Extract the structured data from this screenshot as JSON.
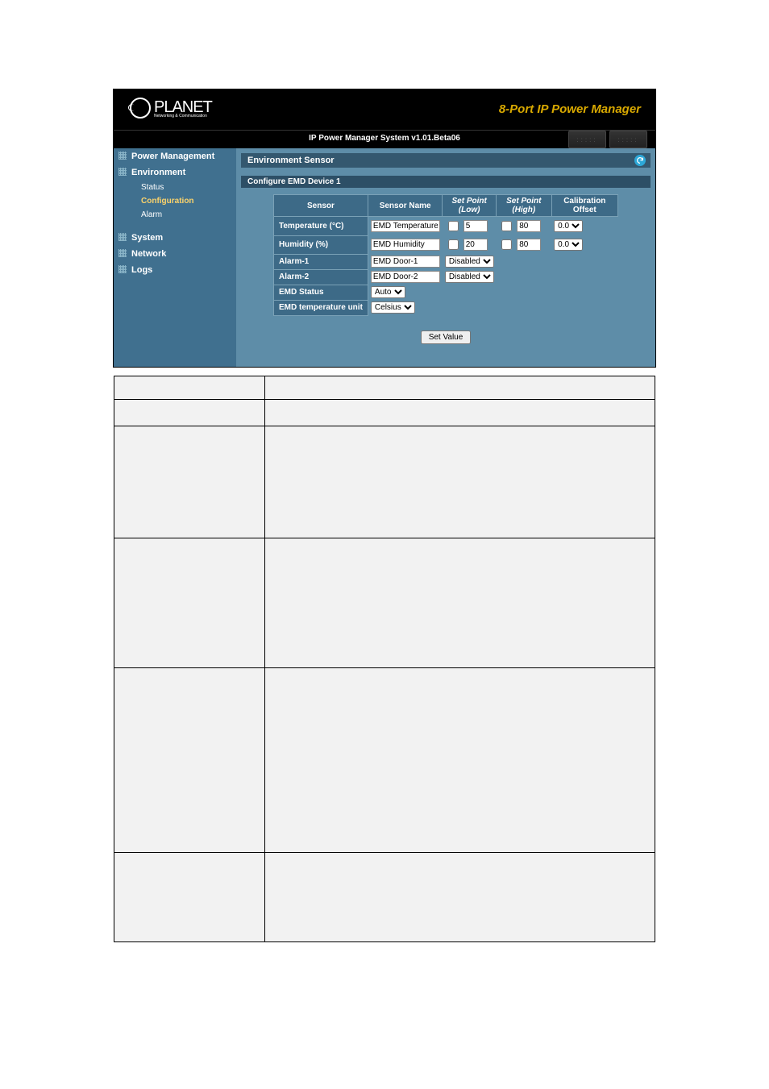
{
  "branding": {
    "logo_text": "PLANET",
    "logo_sub": "Networking & Communication"
  },
  "product_title": "8-Port IP Power Manager",
  "system_status": "IP Power Manager System v1.01.Beta06",
  "sidebar": {
    "items": [
      {
        "label": "Power Management",
        "type": "top",
        "active": false
      },
      {
        "label": "Environment",
        "type": "top",
        "active": false
      },
      {
        "label": "Status",
        "type": "sub",
        "active": false
      },
      {
        "label": "Configuration",
        "type": "sub",
        "active": true
      },
      {
        "label": "Alarm",
        "type": "sub",
        "active": false
      },
      {
        "label": "System",
        "type": "top",
        "active": false
      },
      {
        "label": "Network",
        "type": "top",
        "active": false
      },
      {
        "label": "Logs",
        "type": "top",
        "active": false
      }
    ]
  },
  "main": {
    "section_title": "Environment Sensor",
    "sub_title": "Configure EMD Device 1",
    "headers": {
      "sensor": "Sensor",
      "sensor_name": "Sensor Name",
      "sp_low": "Set Point (Low)",
      "sp_high": "Set Point (High)",
      "calib": "Calibration Offset"
    },
    "rows": {
      "temp": {
        "label": "Temperature (°C)",
        "name": "EMD Temperature",
        "low_chk": false,
        "low_val": "5",
        "high_chk": false,
        "high_val": "80",
        "calib": "0.0"
      },
      "hum": {
        "label": "Humidity (%)",
        "name": "EMD Humidity",
        "low_chk": false,
        "low_val": "20",
        "high_chk": false,
        "high_val": "80",
        "calib": "0.0"
      },
      "a1": {
        "label": "Alarm-1",
        "name": "EMD Door-1",
        "sel": "Disabled"
      },
      "a2": {
        "label": "Alarm-2",
        "name": "EMD Door-2",
        "sel": "Disabled"
      },
      "emd_status": {
        "label": "EMD Status",
        "sel": "Auto"
      },
      "emd_unit": {
        "label": "EMD temperature unit",
        "sel": "Celsius"
      }
    },
    "button": "Set Value"
  }
}
